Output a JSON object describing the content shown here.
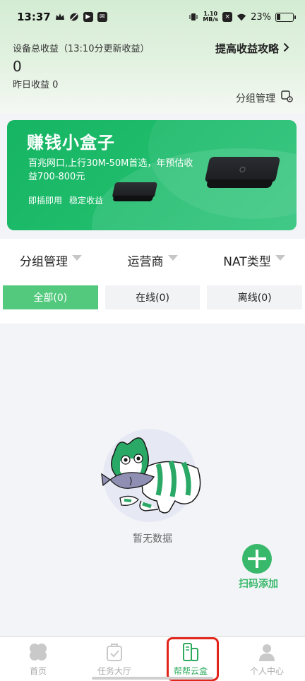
{
  "status_bar": {
    "time": "13:37",
    "speed_value": "1.10",
    "speed_unit": "MB/s",
    "battery": "23%"
  },
  "header": {
    "earnings_title": "设备总收益（13:10分更新收益）",
    "earnings_value": "0",
    "yesterday_label": "昨日收益 0",
    "strategy_link": "提高收益攻略",
    "group_manage": "分组管理"
  },
  "banner": {
    "title": "赚钱小盒子",
    "description": "百兆网口,上行30M-50M首选，年预估收益700-800元",
    "tags": [
      "即插即用",
      "稳定收益"
    ]
  },
  "filters": {
    "dropdowns": [
      "分组管理",
      "运营商",
      "NAT类型"
    ],
    "tabs": [
      {
        "label": "全部(0)",
        "active": true
      },
      {
        "label": "在线(0)",
        "active": false
      },
      {
        "label": "离线(0)",
        "active": false
      }
    ]
  },
  "empty_state": {
    "text": "暂无数据"
  },
  "fab": {
    "label": "扫码添加"
  },
  "bottom_nav": {
    "items": [
      {
        "label": "首页",
        "icon": "clover-icon",
        "active": false
      },
      {
        "label": "任务大厅",
        "icon": "task-bag-icon",
        "active": false
      },
      {
        "label": "帮帮云盒",
        "icon": "device-box-icon",
        "active": true
      },
      {
        "label": "个人中心",
        "icon": "person-icon",
        "active": false
      }
    ]
  },
  "colors": {
    "accent": "#38b86a",
    "tab_active": "#53c97d",
    "banner": "#1dbb6a",
    "highlight": "#e1251b"
  }
}
